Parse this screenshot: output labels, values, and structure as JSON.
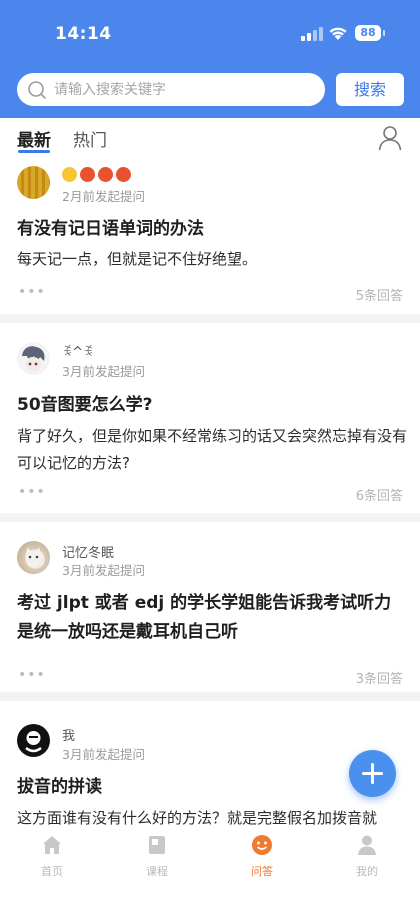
{
  "status": {
    "time": "14:14",
    "battery": "88"
  },
  "search": {
    "placeholder": "请输入搜索关键字",
    "button": "搜索"
  },
  "tabs": [
    {
      "label": "最新",
      "active": true
    },
    {
      "label": "热门",
      "active": false
    }
  ],
  "posts": [
    {
      "user": "",
      "time": "2月前发起提问",
      "title": "有没有记日语单词的办法",
      "body": "每天记一点，但就是记不住好绝望。",
      "answers": "5条回答"
    },
    {
      "user": "ꉂ^ꉂ",
      "time": "3月前发起提问",
      "title": "50音图要怎么学?",
      "body": "背了好久，但是你如果不经常练习的话又会突然忘掉有没有可以记忆的方法?",
      "answers": "6条回答"
    },
    {
      "user": "记忆冬眠",
      "time": "3月前发起提问",
      "title": "考过 jlpt 或者 edj 的学长学姐能告诉我考试听力是统一放吗还是戴耳机自己听",
      "body": "",
      "answers": "3条回答"
    },
    {
      "user": "我",
      "time": "3月前发起提问",
      "title": "拔音的拼读",
      "body": "这方面谁有没有什么好的方法？就是完整假名加拨音就",
      "answers": ""
    }
  ],
  "nav": [
    {
      "label": "首页",
      "icon": "home-icon"
    },
    {
      "label": "课程",
      "icon": "book-icon"
    },
    {
      "label": "问答",
      "icon": "qa-icon",
      "active": true
    },
    {
      "label": "我的",
      "icon": "profile-icon"
    }
  ],
  "colors": {
    "brand": "#4a86ec",
    "accent": "#3a7be8",
    "active_nav": "#f07a2e"
  }
}
